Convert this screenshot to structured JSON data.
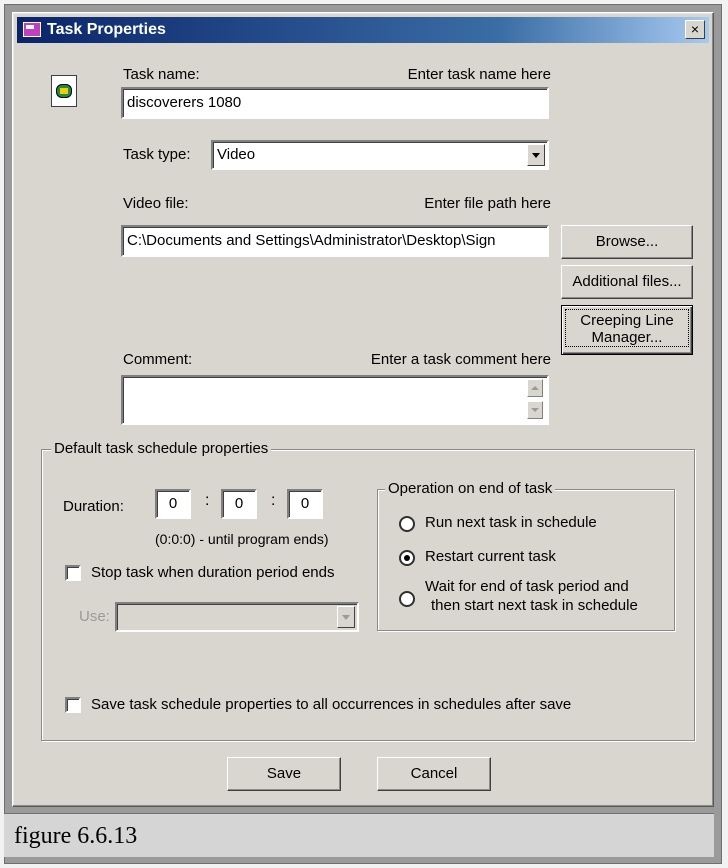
{
  "window": {
    "title": "Task Properties",
    "close_glyph": "×"
  },
  "task_name": {
    "label": "Task name:",
    "hint": "Enter task name here",
    "value": "discoverers 1080"
  },
  "task_type": {
    "label": "Task type:",
    "value": "Video"
  },
  "video_file": {
    "label": "Video file:",
    "hint": "Enter file path here",
    "value": "C:\\Documents and Settings\\Administrator\\Desktop\\Sign"
  },
  "buttons": {
    "browse": "Browse...",
    "additional_files": "Additional files...",
    "creeping_line_1": "Creeping Line",
    "creeping_line_2": "Manager...",
    "save": "Save",
    "cancel": "Cancel"
  },
  "comment": {
    "label": "Comment:",
    "hint": "Enter a task comment here",
    "value": ""
  },
  "schedule": {
    "group_title": "Default task schedule properties",
    "duration_label": "Duration:",
    "duration_h": "0",
    "duration_m": "0",
    "duration_s": "0",
    "duration_note": "(0:0:0) - until program ends)",
    "stop_task_label": "Stop task when duration period ends",
    "stop_task_checked": false,
    "use_label": "Use:",
    "use_value": ""
  },
  "operation": {
    "group_title": "Operation on end of task",
    "options": [
      {
        "label": "Run next task in schedule",
        "checked": false
      },
      {
        "label": "Restart current task",
        "checked": true
      },
      {
        "label_1": "Wait for end of task period and",
        "label_2": "then start next task in schedule",
        "checked": false
      }
    ]
  },
  "save_all": {
    "label": "Save task schedule properties to all occurrences in schedules after save",
    "checked": false
  },
  "caption": "figure 6.6.13"
}
